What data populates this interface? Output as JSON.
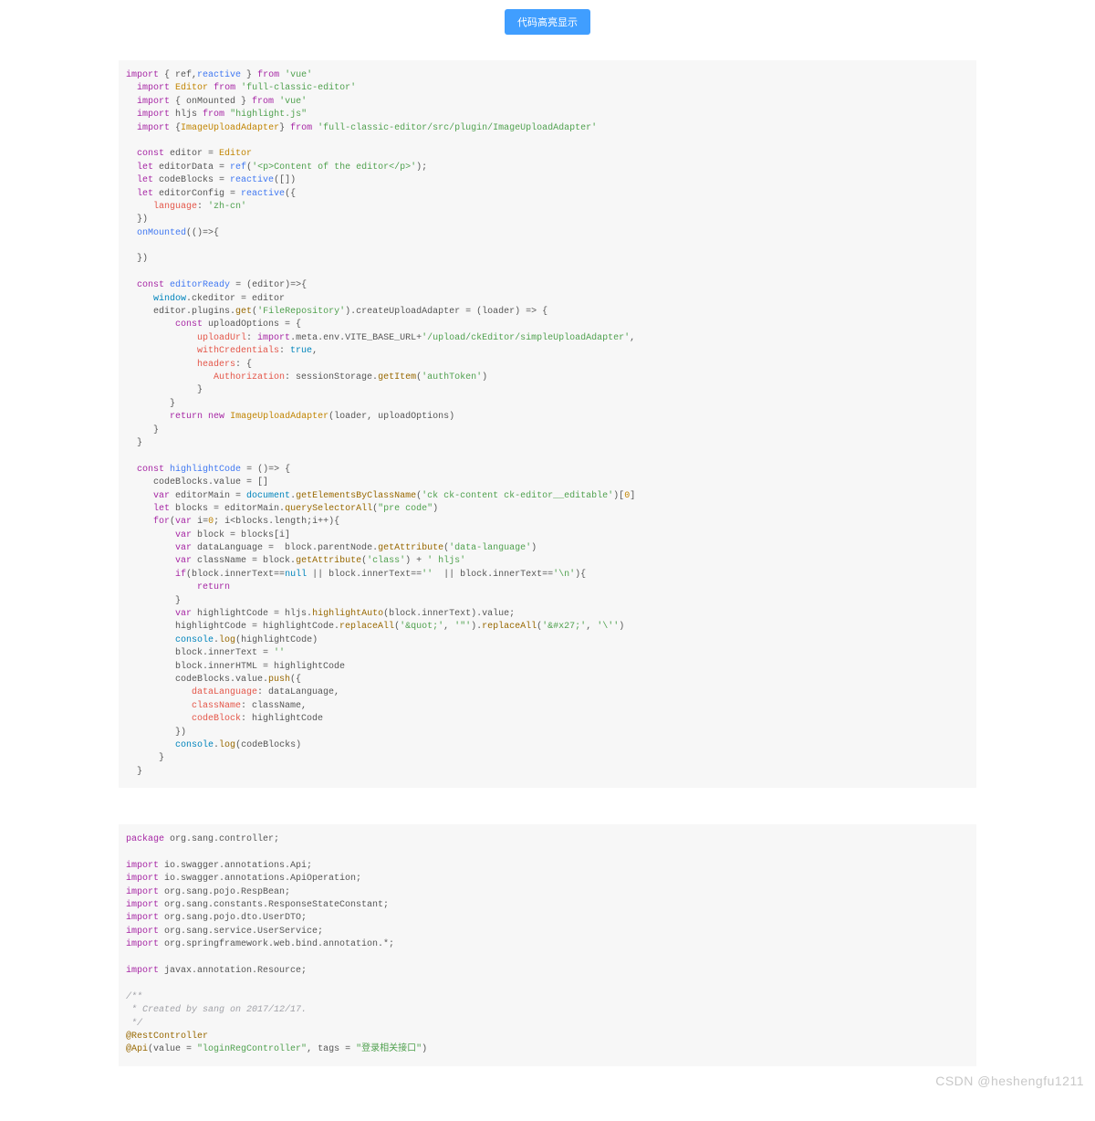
{
  "header": {
    "button_label": "代码高亮显示"
  },
  "watermark": "CSDN @heshengfu1211",
  "block1": {
    "lines": [
      {
        "html": "<span class='kw'>import</span> { ref,<span class='call'>reactive</span> } <span class='kw'>from</span> <span class='str'>'vue'</span>"
      },
      {
        "html": "  <span class='kw'>import</span> <span class='cls'>Editor</span> <span class='kw'>from</span> <span class='str'>'full-classic-editor'</span>"
      },
      {
        "html": "  <span class='kw'>import</span> { onMounted } <span class='kw'>from</span> <span class='str'>'vue'</span>"
      },
      {
        "html": "  <span class='kw'>import</span> hljs <span class='kw'>from</span> <span class='str'>&quot;highlight.js&quot;</span>"
      },
      {
        "html": "  <span class='kw'>import</span> {<span class='cls'>ImageUploadAdapter</span>} <span class='kw'>from</span> <span class='str'>'full-classic-editor/src/plugin/ImageUploadAdapter'</span>"
      },
      {
        "html": "&nbsp;"
      },
      {
        "html": "  <span class='kw'>const</span> editor = <span class='cls'>Editor</span>"
      },
      {
        "html": "  <span class='kw'>let</span> editorData = <span class='call'>ref</span>(<span class='str'>'&lt;p&gt;Content of the editor&lt;/p&gt;'</span>);"
      },
      {
        "html": "  <span class='kw'>let</span> codeBlocks = <span class='call'>reactive</span>([])"
      },
      {
        "html": "  <span class='kw'>let</span> editorConfig = <span class='call'>reactive</span>({"
      },
      {
        "html": "     <span class='prop'>language</span>: <span class='str'>'zh-cn'</span>"
      },
      {
        "html": "  })"
      },
      {
        "html": "  <span class='call'>onMounted</span>(()=&gt;{"
      },
      {
        "html": "&nbsp;"
      },
      {
        "html": "  })"
      },
      {
        "html": "&nbsp;"
      },
      {
        "html": "  <span class='kw'>const</span> <span class='call'>editorReady</span> = (editor)=&gt;{"
      },
      {
        "html": "     <span class='bool'>window</span>.ckeditor = editor"
      },
      {
        "html": "     editor.plugins.<span class='method'>get</span>(<span class='str'>'FileRepository'</span>).createUploadAdapter = (loader) =&gt; {"
      },
      {
        "html": "         <span class='kw'>const</span> uploadOptions = {"
      },
      {
        "html": "             <span class='prop'>uploadUrl</span>: <span class='kw'>import</span>.meta.env.VITE_BASE_URL+<span class='str'>'/upload/ckEditor/simpleUploadAdapter'</span>,"
      },
      {
        "html": "             <span class='prop'>withCredentials</span>: <span class='bool'>true</span>,"
      },
      {
        "html": "             <span class='prop'>headers</span>: {"
      },
      {
        "html": "                <span class='prop'>Authorization</span>: sessionStorage.<span class='method'>getItem</span>(<span class='str'>'authToken'</span>)"
      },
      {
        "html": "             }"
      },
      {
        "html": "        }"
      },
      {
        "html": "        <span class='kw'>return</span> <span class='kw'>new</span> <span class='cls'>ImageUploadAdapter</span>(loader, uploadOptions)"
      },
      {
        "html": "     }"
      },
      {
        "html": "  }"
      },
      {
        "html": "&nbsp;"
      },
      {
        "html": "  <span class='kw'>const</span> <span class='call'>highlightCode</span> = ()=&gt; {"
      },
      {
        "html": "     codeBlocks.value = []"
      },
      {
        "html": "     <span class='kw'>var</span> editorMain = <span class='bool'>document</span>.<span class='method'>getElementsByClassName</span>(<span class='str'>'ck ck-content ck-editor__editable'</span>)[<span class='num'>0</span>]"
      },
      {
        "html": "     <span class='kw'>let</span> blocks = editorMain.<span class='method'>querySelectorAll</span>(<span class='str'>&quot;pre code&quot;</span>)"
      },
      {
        "html": "     <span class='kw'>for</span>(<span class='kw'>var</span> i=<span class='num'>0</span>; i&lt;blocks.length;i++){"
      },
      {
        "html": "         <span class='kw'>var</span> block = blocks[i]"
      },
      {
        "html": "         <span class='kw'>var</span> dataLanguage =  block.parentNode.<span class='method'>getAttribute</span>(<span class='str'>'data-language'</span>)"
      },
      {
        "html": "         <span class='kw'>var</span> className = block.<span class='method'>getAttribute</span>(<span class='str'>'class'</span>) + <span class='str'>' hljs'</span>"
      },
      {
        "html": "         <span class='kw'>if</span>(block.innerText==<span class='bool'>null</span> || block.innerText==<span class='str'>''</span>  || block.innerText==<span class='str'>'\\n'</span>){"
      },
      {
        "html": "             <span class='kw'>return</span>"
      },
      {
        "html": "         }"
      },
      {
        "html": "         <span class='kw'>var</span> highlightCode = hljs.<span class='method'>highlightAuto</span>(block.innerText).value;"
      },
      {
        "html": "         highlightCode = highlightCode.<span class='method'>replaceAll</span>(<span class='str'>'&amp;quot;'</span>, <span class='str'>'&quot;'</span>).<span class='method'>replaceAll</span>(<span class='str'>'&amp;#x27;'</span>, <span class='str'>'\\''</span>)"
      },
      {
        "html": "         <span class='bool'>console</span>.<span class='method'>log</span>(highlightCode)"
      },
      {
        "html": "         block.innerText = <span class='str'>''</span>"
      },
      {
        "html": "         block.innerHTML = highlightCode"
      },
      {
        "html": "         codeBlocks.value.<span class='method'>push</span>({"
      },
      {
        "html": "            <span class='prop'>dataLanguage</span>: dataLanguage,"
      },
      {
        "html": "            <span class='prop'>className</span>: className,"
      },
      {
        "html": "            <span class='prop'>codeBlock</span>: highlightCode"
      },
      {
        "html": "         })"
      },
      {
        "html": "         <span class='bool'>console</span>.<span class='method'>log</span>(codeBlocks)"
      },
      {
        "html": "      }"
      },
      {
        "html": "  }"
      }
    ]
  },
  "block2": {
    "lines": [
      {
        "html": "<span class='kw'>package</span> org.sang.controller;"
      },
      {
        "html": "&nbsp;"
      },
      {
        "html": "<span class='kw'>import</span> io.swagger.annotations.Api;"
      },
      {
        "html": "<span class='kw'>import</span> io.swagger.annotations.ApiOperation;"
      },
      {
        "html": "<span class='kw'>import</span> org.sang.pojo.RespBean;"
      },
      {
        "html": "<span class='kw'>import</span> org.sang.constants.ResponseStateConstant;"
      },
      {
        "html": "<span class='kw'>import</span> org.sang.pojo.dto.UserDTO;"
      },
      {
        "html": "<span class='kw'>import</span> org.sang.service.UserService;"
      },
      {
        "html": "<span class='kw'>import</span> org.springframework.web.bind.annotation.*;"
      },
      {
        "html": "&nbsp;"
      },
      {
        "html": "<span class='kw'>import</span> javax.annotation.Resource;"
      },
      {
        "html": "&nbsp;"
      },
      {
        "html": "<span class='cmt'>/**</span>"
      },
      {
        "html": "<span class='cmt'> * Created by sang on 2017/12/17.</span>"
      },
      {
        "html": "<span class='cmt'> */</span>"
      },
      {
        "html": "<span class='ann'>@RestController</span>"
      },
      {
        "html": "<span class='ann'>@Api</span>(value = <span class='str'>&quot;loginRegController&quot;</span>, tags = <span class='str'>&quot;登录相关接口&quot;</span>)"
      }
    ]
  }
}
